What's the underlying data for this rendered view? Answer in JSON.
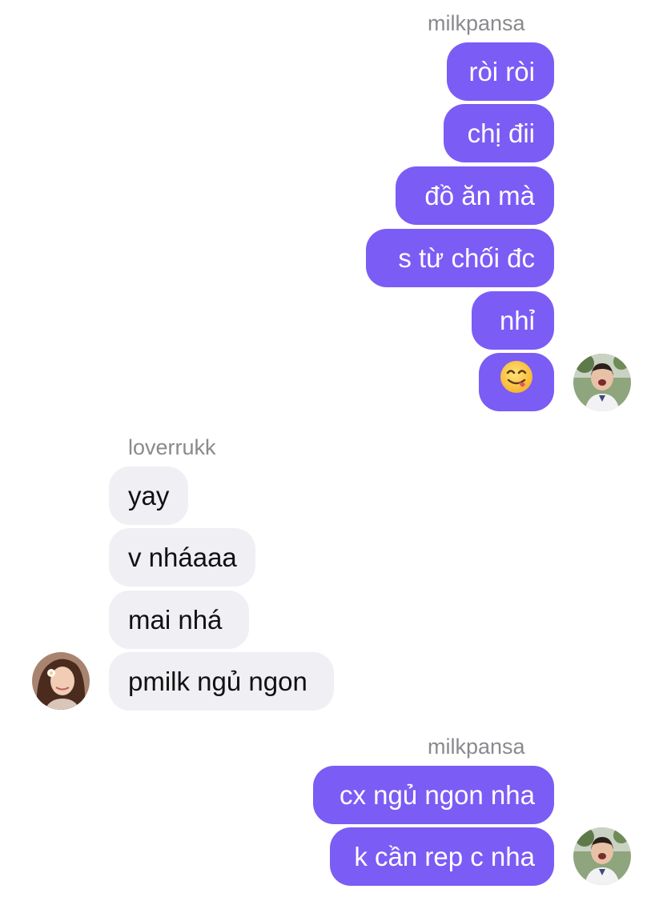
{
  "groups": [
    {
      "sender": "milkpansa",
      "messages": [
        "ròi ròi",
        "chị đii",
        "đồ ăn mà",
        "s từ chối đc",
        "nhỉ",
        "😋"
      ],
      "avatar": "user-avatar-icon"
    },
    {
      "sender": "loverrukk",
      "messages": [
        "yay",
        "v nháaaa",
        "mai nhá",
        "pmilk ngủ ngon"
      ],
      "avatar": "contact-avatar-icon"
    },
    {
      "sender": "milkpansa",
      "messages": [
        "cx ngủ ngon nha",
        "k cần rep c nha"
      ],
      "avatar": "user-avatar-icon"
    }
  ],
  "colors": {
    "outgoing_bubble": "#7b5cf5",
    "incoming_bubble": "#efeff4",
    "sender_label": "#8a8a8e"
  }
}
